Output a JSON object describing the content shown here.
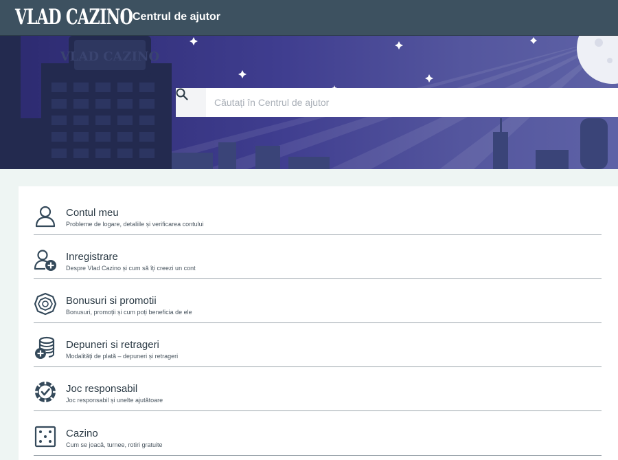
{
  "header": {
    "logo_text": "VLAD CAZINO",
    "title": "Centrul de ajutor"
  },
  "hero": {
    "building_sign": "VLAD CAZINO"
  },
  "search": {
    "placeholder": "Căutați în Centrul de ajutor",
    "value": "",
    "icon": "search-icon"
  },
  "categories": [
    {
      "title": "Contul meu",
      "description": "Probleme de logare, detaliile și verificarea contului",
      "icon": "user-icon"
    },
    {
      "title": "Inregistrare",
      "description": "Despre Vlad Cazino și cum să îți creezi un cont",
      "icon": "user-add-icon"
    },
    {
      "title": "Bonusuri si promotii",
      "description": "Bonusuri, promoții și cum poți beneficia de ele",
      "icon": "gem-icon"
    },
    {
      "title": "Depuneri si retrageri",
      "description": "Modalități de plată – depuneri și retrageri",
      "icon": "coins-add-icon"
    },
    {
      "title": "Joc responsabil",
      "description": "Joc responsabil și unelte ajutătoare",
      "icon": "chip-check-icon"
    },
    {
      "title": "Cazino",
      "description": "Cum se joacă, turnee, rotiri gratuite",
      "icon": "dice-icon"
    }
  ],
  "colors": {
    "topbar": "#3d5160",
    "hero_dark": "#2c2a6f",
    "hero_light": "#5e62a6",
    "icon": "#34495a",
    "page_bg": "#eef5f3"
  }
}
